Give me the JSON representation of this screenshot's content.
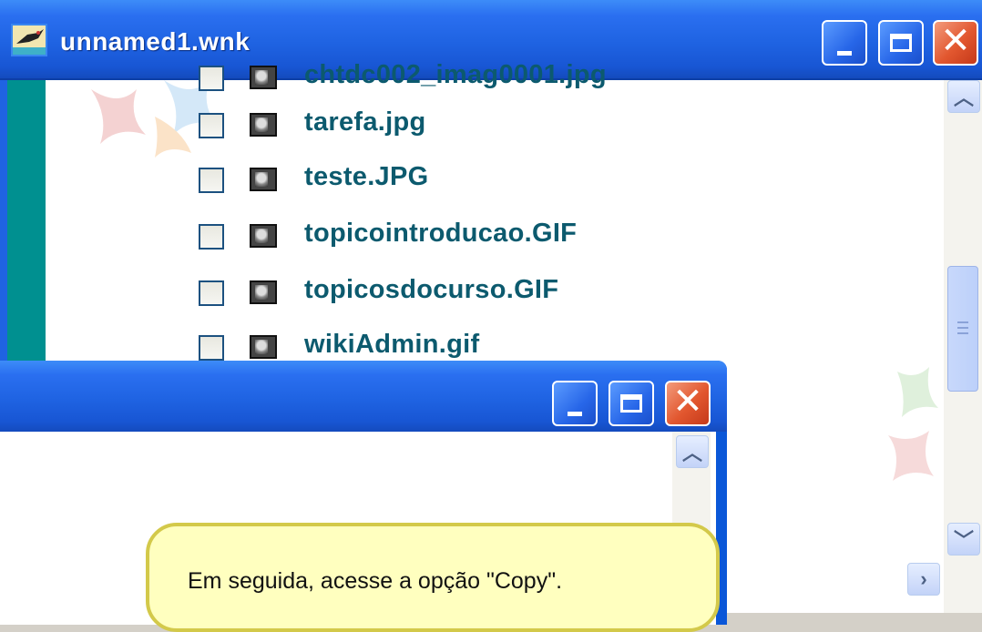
{
  "back_window": {
    "title": "unnamed1.wnk",
    "files": [
      {
        "name": "chtdc002_imag0001.jpg"
      },
      {
        "name": "tarefa.jpg"
      },
      {
        "name": "teste.JPG"
      },
      {
        "name": "topicointroducao.GIF"
      },
      {
        "name": "topicosdocurso.GIF"
      },
      {
        "name": "wikiAdmin.gif"
      }
    ]
  },
  "front_window": {
    "title": ""
  },
  "tooltip": {
    "text": "Em seguida, acesse a opção \"Copy\"."
  },
  "colors": {
    "titlebar": "#1f63e2",
    "file_text": "#0c5a6e",
    "teal_bar": "#009090",
    "tooltip_bg": "#ffffbf",
    "close_button": "#e2572f"
  },
  "icons": {
    "app": "bird-icon",
    "minimize": "minimize-icon",
    "maximize": "maximize-icon",
    "close": "close-icon",
    "scroll_up": "chevron-up-icon",
    "scroll_down": "chevron-down-icon",
    "scroll_right": "chevron-right-icon",
    "file": "image-file-icon"
  }
}
